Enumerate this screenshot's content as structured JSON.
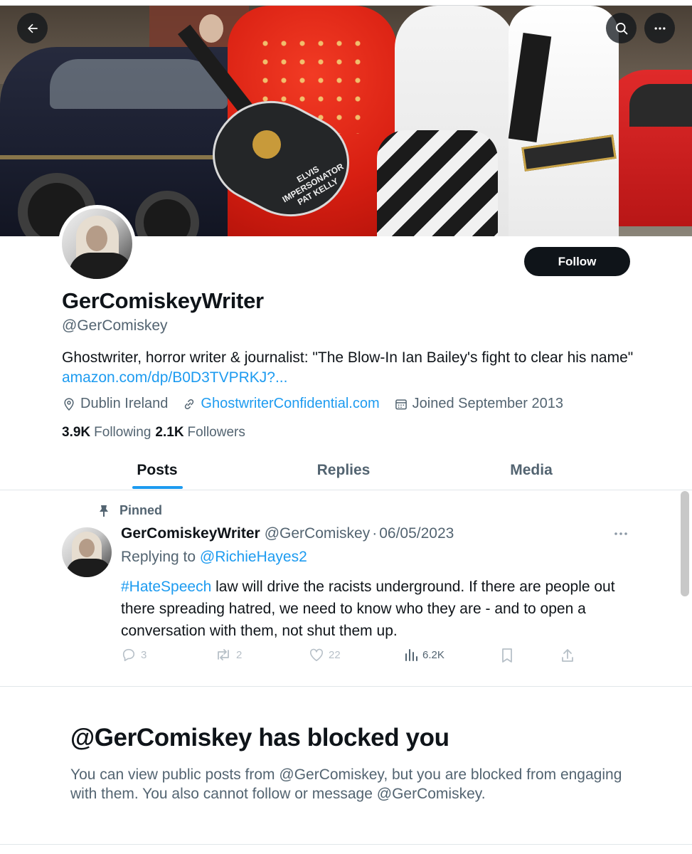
{
  "header": {
    "banner_text": "ELVIS IMPERSONATOR PAT KELLY"
  },
  "profile": {
    "display_name": "GerComiskeyWriter",
    "handle": "@GerComiskey",
    "follow_label": "Follow",
    "bio_text": "Ghostwriter, horror writer & journalist: \"The Blow-In Ian Bailey's fight to clear his name\" ",
    "bio_link": "amazon.com/dp/B0D3TVPRKJ?...",
    "location": "Dublin Ireland",
    "website": "GhostwriterConfidential.com",
    "joined": "Joined September 2013",
    "following_count": "3.9K",
    "following_label": "Following",
    "followers_count": "2.1K",
    "followers_label": "Followers"
  },
  "tabs": [
    {
      "label": "Posts",
      "active": true
    },
    {
      "label": "Replies",
      "active": false
    },
    {
      "label": "Media",
      "active": false
    }
  ],
  "pinned_post": {
    "pinned_label": "Pinned",
    "author_name": "GerComiskeyWriter",
    "author_handle": "@GerComiskey",
    "separator": "·",
    "date": "06/05/2023",
    "replying_prefix": "Replying to ",
    "replying_to": "@RichieHayes2",
    "hashtag": "#HateSpeech",
    "text": " law will drive the racists underground. If there are people out there spreading hatred, we need to know who they are - and to open a conversation with them, not shut them up.",
    "replies": "3",
    "reposts": "2",
    "likes": "22",
    "views": "6.2K"
  },
  "blocked": {
    "title": "@GerComiskey has blocked you",
    "message": "You can view public posts from @GerComiskey, but you are blocked from engaging with them. You also cannot follow or message @GerComiskey."
  },
  "colors": {
    "accent": "#1d9bf0",
    "text_primary": "#0f1419",
    "text_secondary": "#536471",
    "follow_button": "#0f1419"
  },
  "icons": {
    "back": "arrow-left-icon",
    "search": "search-icon",
    "more": "more-horizontal-icon",
    "location": "location-pin-icon",
    "link": "link-icon",
    "calendar": "calendar-icon",
    "pin": "pin-icon",
    "reply": "reply-icon",
    "repost": "repost-icon",
    "like": "heart-icon",
    "views": "views-chart-icon",
    "bookmark": "bookmark-icon",
    "share": "share-icon"
  }
}
